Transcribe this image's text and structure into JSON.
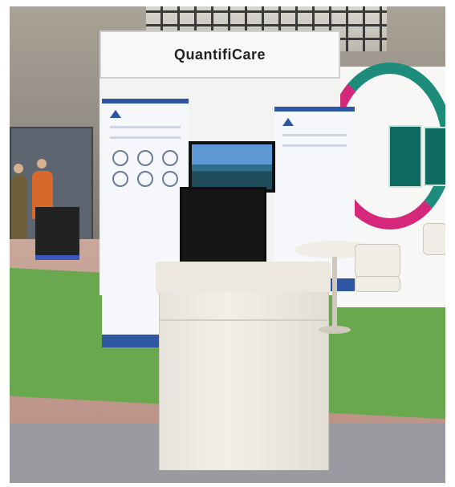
{
  "booth": {
    "header_label": "QuantifiCare"
  },
  "colors": {
    "brand_blue": "#2f56a0",
    "accent_teal": "#1e8c7a",
    "accent_magenta": "#d5287a",
    "carpet_green": "#6aa84f"
  }
}
